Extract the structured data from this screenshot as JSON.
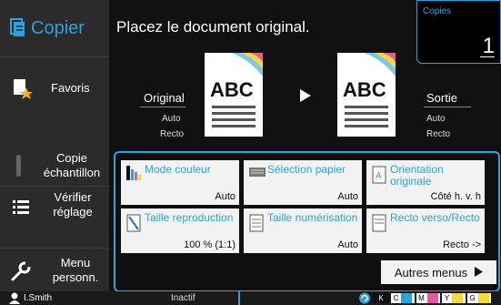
{
  "app": {
    "title": "Copier"
  },
  "header": {
    "message": "Placez le document original."
  },
  "copies": {
    "label": "Copies",
    "value": "1"
  },
  "sidebar": {
    "items": [
      {
        "label": "Favoris",
        "icon": "star-icon"
      },
      {
        "label": "Copie\néchantillon",
        "icon": "sample-copy-icon"
      },
      {
        "label": "Vérifier\nréglage",
        "icon": "list-icon"
      },
      {
        "label": "Menu\npersonn.",
        "icon": "wrench-icon"
      }
    ]
  },
  "preview": {
    "original_label": "Original",
    "original_mode": "Auto",
    "original_duplex": "Recto",
    "output_label": "Sortie",
    "output_mode": "Auto",
    "output_duplex": "Recto",
    "doc_text": "ABC"
  },
  "settings": [
    {
      "title": "Mode couleur",
      "value": "Auto"
    },
    {
      "title": "Sélection papier",
      "value": "Auto"
    },
    {
      "title": "Orientation originale",
      "value": "Côté h. v. h"
    },
    {
      "title": "Taille reproduction",
      "value": "100 % (1:1)"
    },
    {
      "title": "Taille numérisation",
      "value": "Auto"
    },
    {
      "title": "Recto verso/Recto",
      "value": "Recto ->"
    }
  ],
  "more_menus": "Autres menus",
  "status": {
    "user": "I.Smith",
    "state": "Inactif",
    "toner": [
      "K",
      "C",
      "M",
      "Y",
      "G"
    ]
  },
  "colors": {
    "accent": "#2aa3e0",
    "sidebar": "#2b2b2b",
    "card": "#f2f2f2"
  }
}
